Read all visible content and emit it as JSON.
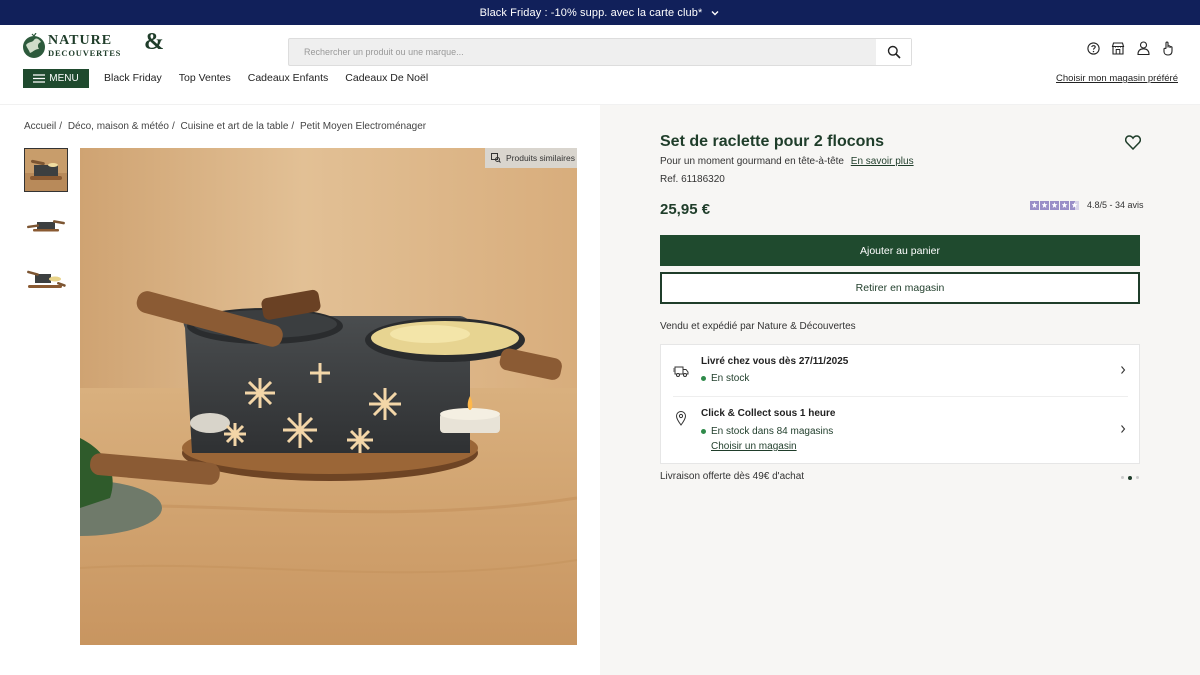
{
  "promo": {
    "text": "Black Friday : -10% supp. avec la carte club*"
  },
  "logo": {
    "line1": "NATURE",
    "line2": "DECOUVERTES",
    "amp": "&"
  },
  "search": {
    "placeholder": "Rechercher un produit ou une marque..."
  },
  "header_icons": [
    "help-icon",
    "store-icon",
    "account-icon",
    "cart-icon"
  ],
  "menu": {
    "label": "MENU"
  },
  "nav": [
    "Black Friday",
    "Top Ventes",
    "Cadeaux Enfants",
    "Cadeaux De Noël"
  ],
  "store_link": "Choisir mon magasin préféré",
  "breadcrumb": [
    "Accueil",
    "Déco, maison & météo",
    "Cuisine et art de la table",
    "Petit Moyen Electroménager"
  ],
  "gallery": {
    "similar_label": "Produits similaires"
  },
  "product": {
    "title": "Set de raclette pour 2 flocons",
    "subtitle": "Pour un moment gourmand en tête-à-tête",
    "learn_more": "En savoir plus",
    "ref": "Ref. 61186320",
    "price": "25,95 €",
    "rating_value": 4.8,
    "rating_text": "4.8/5 - 34 avis",
    "add_to_cart": "Ajouter au panier",
    "pickup": "Retirer en magasin",
    "sold_by": "Vendu et expédié par Nature & Découvertes"
  },
  "delivery": {
    "home_title": "Livré chez vous dès 27/11/2025",
    "home_status": "En stock",
    "collect_title": "Click & Collect sous 1 heure",
    "collect_status": "En stock dans 84 magasins",
    "collect_link": "Choisir un magasin"
  },
  "free_shipping": "Livraison offerte dès 49€ d'achat",
  "colors": {
    "brand_green": "#1f4a2e",
    "promo_navy": "#11205a",
    "panel_bg": "#f7f6f4"
  }
}
